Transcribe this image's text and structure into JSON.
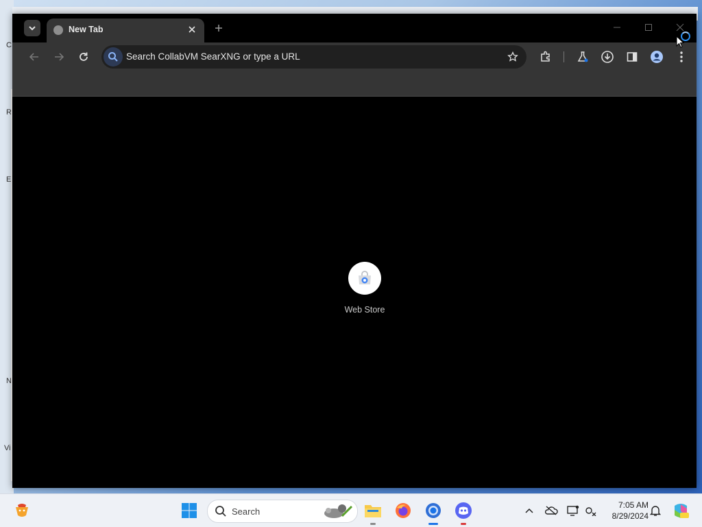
{
  "desktop": {
    "letters": [
      "C",
      "R",
      "E",
      "N",
      "Vi"
    ]
  },
  "browser": {
    "tab": {
      "title": "New Tab",
      "close_glyph": "✕"
    },
    "new_tab_glyph": "+",
    "window_controls": {
      "minimize": "─",
      "maximize": "☐",
      "close": "✕"
    },
    "toolbar": {
      "back_glyph": "←",
      "forward_glyph": "→",
      "omnibox_placeholder": "Search CollabVM SearXNG or type a URL"
    },
    "shortcuts": [
      {
        "label": "Web Store"
      }
    ]
  },
  "taskbar": {
    "search_placeholder": "Search",
    "clock": {
      "time": "7:05 AM",
      "date": "8/29/2024"
    },
    "apps": [
      "file-explorer",
      "firefox",
      "chrome",
      "discord"
    ]
  },
  "colors": {
    "chrome_dark": "#353535",
    "omnibox_bg": "#202020",
    "accent_blue": "#1a73e8"
  }
}
